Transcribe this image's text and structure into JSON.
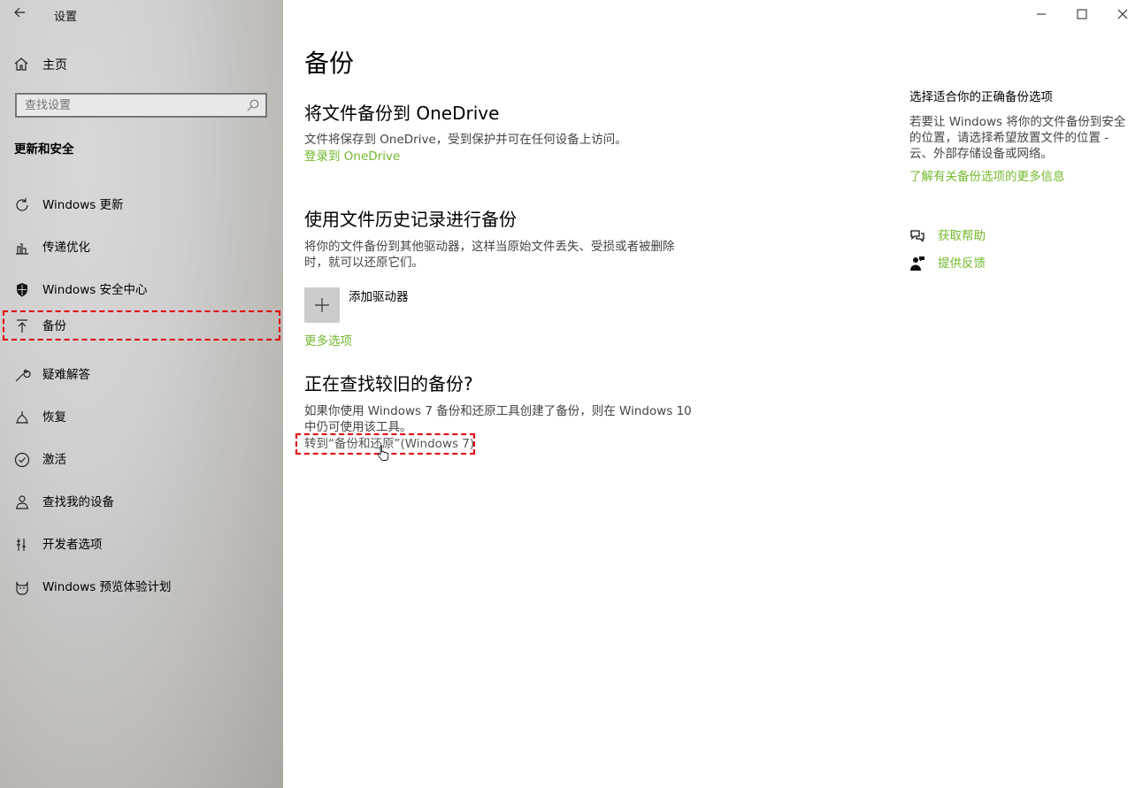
{
  "window": {
    "title": "设置"
  },
  "sidebar": {
    "home_label": "主页",
    "search_placeholder": "查找设置",
    "section_title": "更新和安全",
    "items": [
      {
        "label": "Windows 更新",
        "icon": "refresh-icon"
      },
      {
        "label": "传递优化",
        "icon": "delivery-optimization-icon"
      },
      {
        "label": "Windows 安全中心",
        "icon": "shield-icon"
      },
      {
        "label": "备份",
        "icon": "backup-arrow-icon",
        "active": true
      },
      {
        "label": "疑难解答",
        "icon": "wrench-icon"
      },
      {
        "label": "恢复",
        "icon": "recovery-icon"
      },
      {
        "label": "激活",
        "icon": "checkmark-circle-icon"
      },
      {
        "label": "查找我的设备",
        "icon": "person-location-icon"
      },
      {
        "label": "开发者选项",
        "icon": "developer-tools-icon"
      },
      {
        "label": "Windows 预览体验计划",
        "icon": "insider-cat-icon"
      }
    ]
  },
  "main": {
    "page_title": "备份",
    "onedrive": {
      "heading": "将文件备份到 OneDrive",
      "description": "文件将保存到 OneDrive，受到保护并可在任何设备上访问。",
      "link": "登录到 OneDrive"
    },
    "file_history": {
      "heading": "使用文件历史记录进行备份",
      "description": "将你的文件备份到其他驱动器，这样当原始文件丢失、受损或者被删除时，就可以还原它们。",
      "add_drive_label": "添加驱动器",
      "more_options": "更多选项"
    },
    "older_backup": {
      "heading": "正在查找较旧的备份?",
      "description": "如果你使用 Windows 7 备份和还原工具创建了备份，则在 Windows 10 中仍可使用该工具。",
      "goto_link": "转到“备份和还原”(Windows 7)"
    }
  },
  "right_panel": {
    "heading": "选择适合你的正确备份选项",
    "description": "若要让 Windows 将你的文件备份到安全的位置，请选择希望放置文件的位置 - 云、外部存储设备或网络。",
    "learn_more": "了解有关备份选项的更多信息",
    "get_help": "获取帮助",
    "feedback": "提供反馈"
  },
  "colors": {
    "accent": "#73b92c",
    "highlight": "#e00000"
  }
}
